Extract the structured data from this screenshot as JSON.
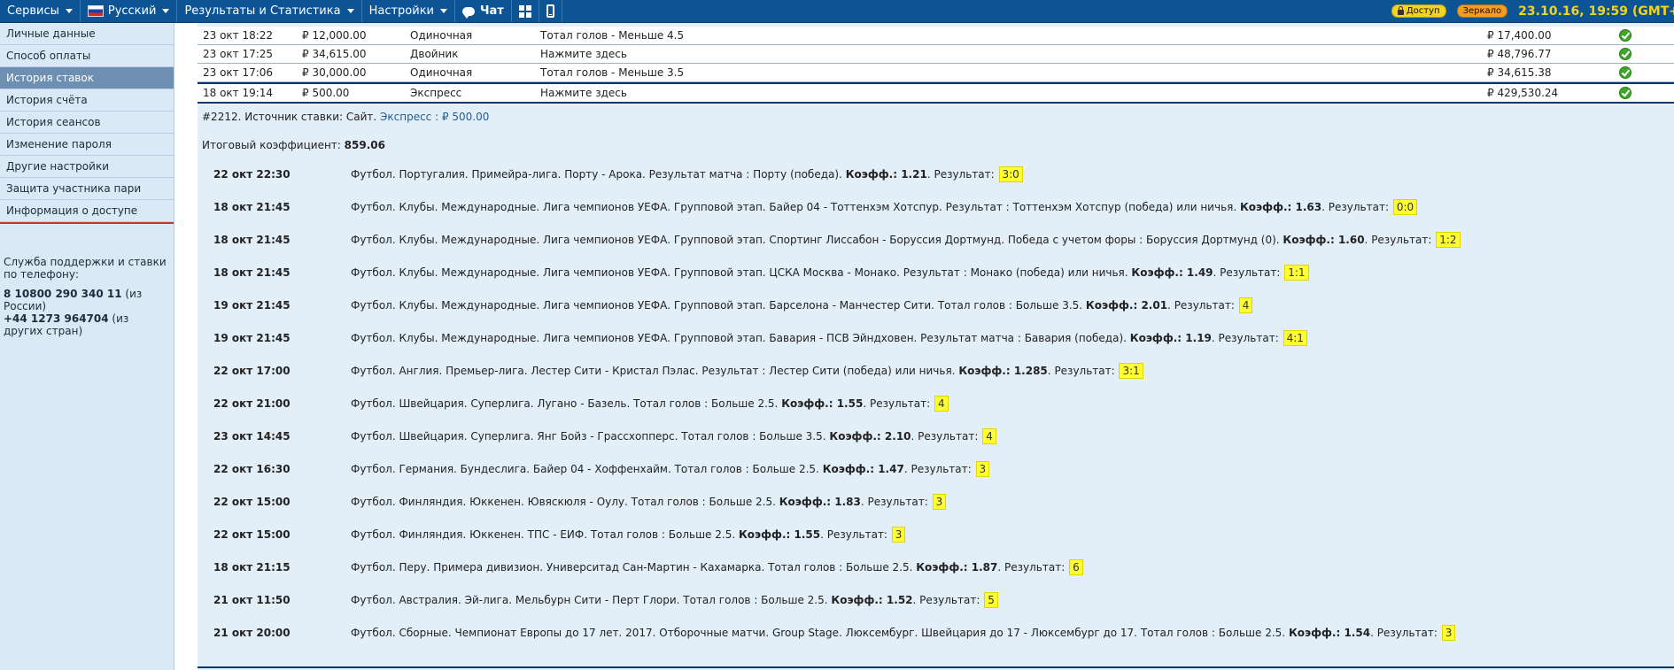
{
  "topbar": {
    "services": "Сервисы",
    "language": "Русский",
    "results": "Результаты и Статистика",
    "settings": "Настройки",
    "chat": "Чат",
    "access": "Доступ",
    "mirror": "Зеркало",
    "datetime": "23.10.16, 19:59 (GMT+"
  },
  "sidebar": {
    "items": [
      {
        "label": "Личные данные"
      },
      {
        "label": "Способ оплаты"
      },
      {
        "label": "История ставок"
      },
      {
        "label": "История счёта"
      },
      {
        "label": "История сеансов"
      },
      {
        "label": "Изменение пароля"
      },
      {
        "label": "Другие настройки"
      },
      {
        "label": "Защита участника пари"
      },
      {
        "label": "Информация о доступе"
      }
    ],
    "support_title": "Служба поддержки и ставки по телефону:",
    "phone_ru": "8 10800 290 340 11",
    "phone_ru_note": " (из России)",
    "phone_intl": "+44 1273 964704",
    "phone_intl_note": " (из других стран)"
  },
  "bets": [
    {
      "date": "23 окт 18:22",
      "stake": "₽ 12,000.00",
      "type": "Одиночная",
      "event": "Тотал голов - Меньше 4.5",
      "payout": "₽ 17,400.00"
    },
    {
      "date": "23 окт 17:25",
      "stake": "₽ 34,615.00",
      "type": "Двойник",
      "event": "Нажмите здесь",
      "payout": "₽ 48,796.77"
    },
    {
      "date": "23 окт 17:06",
      "stake": "₽ 30,000.00",
      "type": "Одиночная",
      "event": "Тотал голов - Меньше 3.5",
      "payout": "₽ 34,615.38"
    },
    {
      "date": "18 окт 19:14",
      "stake": "₽ 500.00",
      "type": "Экспресс",
      "event": "Нажмите здесь",
      "payout": "₽ 429,530.24"
    }
  ],
  "detail": {
    "source_prefix": "#2212. Источник ставки: Сайт. ",
    "source_type": "Экспресс",
    "source_amount": " : ₽ 500.00",
    "total_label": "Итоговый коэффициент: ",
    "total_value": "859.06"
  },
  "events": [
    {
      "dt": "22 окт 22:30",
      "desc": "Футбол. Португалия. Примейра-лига. Порту - Арока. Результат матча : Порту (победа). ",
      "odds": "1.21",
      "result": "3:0"
    },
    {
      "dt": "18 окт 21:45",
      "desc": "Футбол. Клубы. Международные. Лига чемпионов УЕФА. Групповой этап. Байер 04 - Тоттенхэм Хотспур. Результат : Тоттенхэм Хотспур (победа) или ничья. ",
      "odds": "1.63",
      "result": "0:0"
    },
    {
      "dt": "18 окт 21:45",
      "desc": "Футбол. Клубы. Международные. Лига чемпионов УЕФА. Групповой этап. Спортинг Лиссабон - Боруссия Дортмунд. Победа с учетом форы : Боруссия Дортмунд (0). ",
      "odds": "1.60",
      "result": "1:2"
    },
    {
      "dt": "18 окт 21:45",
      "desc": "Футбол. Клубы. Международные. Лига чемпионов УЕФА. Групповой этап. ЦСКА Москва - Монако. Результат : Монако (победа) или ничья. ",
      "odds": "1.49",
      "result": "1:1"
    },
    {
      "dt": "19 окт 21:45",
      "desc": "Футбол. Клубы. Международные. Лига чемпионов УЕФА. Групповой этап. Барселона - Манчестер Сити. Тотал голов : Больше 3.5. ",
      "odds": "2.01",
      "result": "4"
    },
    {
      "dt": "19 окт 21:45",
      "desc": "Футбол. Клубы. Международные. Лига чемпионов УЕФА. Групповой этап. Бавария - ПСВ Эйндховен. Результат матча : Бавария (победа). ",
      "odds": "1.19",
      "result": "4:1"
    },
    {
      "dt": "22 окт 17:00",
      "desc": "Футбол. Англия. Премьер-лига. Лестер Сити - Кристал Пэлас. Результат : Лестер Сити (победа) или ничья. ",
      "odds": "1.285",
      "result": "3:1"
    },
    {
      "dt": "22 окт 21:00",
      "desc": "Футбол. Швейцария. Суперлига. Лугано - Базель. Тотал голов : Больше 2.5. ",
      "odds": "1.55",
      "result": "4"
    },
    {
      "dt": "23 окт 14:45",
      "desc": "Футбол. Швейцария. Суперлига. Янг Бойз - Грассхопперс. Тотал голов : Больше 3.5. ",
      "odds": "2.10",
      "result": "4"
    },
    {
      "dt": "22 окт 16:30",
      "desc": "Футбол. Германия. Бундеслига. Байер 04 - Хоффенхайм. Тотал голов : Больше 2.5. ",
      "odds": "1.47",
      "result": "3"
    },
    {
      "dt": "22 окт 15:00",
      "desc": "Футбол. Финляндия. Юккенен. Ювяскюля - Оулу. Тотал голов : Больше 2.5. ",
      "odds": "1.83",
      "result": "3"
    },
    {
      "dt": "22 окт 15:00",
      "desc": "Футбол. Финляндия. Юккенен. ТПС - ЕИФ. Тотал голов : Больше 2.5. ",
      "odds": "1.55",
      "result": "3"
    },
    {
      "dt": "18 окт 21:15",
      "desc": "Футбол. Перу. Примера дивизион. Университад Сан-Мартин - Кахамарка. Тотал голов : Больше 2.5. ",
      "odds": "1.87",
      "result": "6"
    },
    {
      "dt": "21 окт 11:50",
      "desc": "Футбол. Австралия. Эй-лига. Мельбурн Сити - Перт Глори. Тотал голов : Больше 2.5. ",
      "odds": "1.52",
      "result": "5"
    },
    {
      "dt": "21 окт 20:00",
      "desc": "Футбол. Сборные. Чемпионат Европы до 17 лет. 2017. Отборочные матчи. Group Stage. Люксембург. Швейцария до 17 - Люксембург до 17. Тотал голов : Больше 2.5. ",
      "odds": "1.54",
      "result": "3"
    }
  ],
  "labels": {
    "odds_label": "Коэфф.: ",
    "result_label": "Результат: "
  }
}
